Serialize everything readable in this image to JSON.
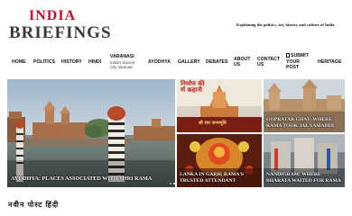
{
  "site": {
    "logo_line1": "INDIA",
    "logo_line2": "BRIEFINGS",
    "tagline": "Explaining the politics, art, history and culture of India"
  },
  "nav": {
    "home": "HOME",
    "politics": "POLITICS",
    "history": "HISTORY",
    "hindi": "HINDI",
    "varanasi": "VARANASI",
    "varanasi_sub1": "India's Sacred",
    "varanasi_sub2": "City Varanasi",
    "ayodhya": "AYODHYA",
    "gallery": "GALLERY",
    "debates": "DEBATES",
    "about1": "ABOUT",
    "about2": "US",
    "contact1": "CONTACT",
    "contact2": "US",
    "submit1": "SUBMIT",
    "submit2": "YOUR",
    "submit3": "POST",
    "heritage": "HERITAGE"
  },
  "featured": {
    "main_caption": "AYODHYA: PLACES ASSOCIATED WITH SHRI RAMA",
    "temple_sign_line1": "निर्माण की",
    "temple_sign_line2": "र्ण कहानी",
    "temple_sign_line3": "श्री राम जन्मभूमि",
    "tile2_caption": "GOPRATAR GHAT: WHERE RAMA TOOK JAL SAMADHI",
    "tile3_caption": "LANKA IN GARH: RAMA'S TRUSTED ATTENDANT",
    "tile4_caption": "NANDIGRAM: WHERE BHARATA WAITED FOR RAMA"
  },
  "section": {
    "heading": "नवीन पोस्ट हिंदी"
  },
  "colors": {
    "logo_red": "#c8102e",
    "logo_gray": "#3a3a3a"
  }
}
